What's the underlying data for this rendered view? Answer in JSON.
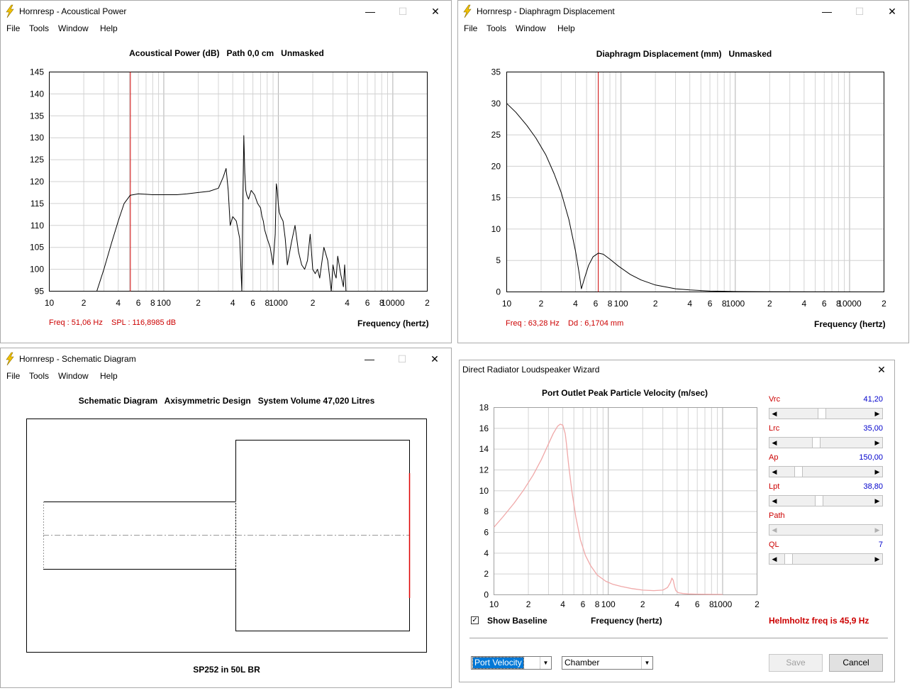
{
  "power_window": {
    "title": "Hornresp - Acoustical Power",
    "menu": [
      "File",
      "Tools",
      "Window",
      "Help"
    ],
    "chart_title": "Acoustical Power (dB)   Path 0,0 cm   Unmasked",
    "readout_freq": "Freq : 51,06 Hz",
    "readout_value": "SPL : 116,8985 dB",
    "xlabel": "Frequency (hertz)"
  },
  "displacement_window": {
    "title": "Hornresp - Diaphragm Displacement",
    "menu": [
      "File",
      "Tools",
      "Window",
      "Help"
    ],
    "chart_title": "Diaphragm Displacement (mm)   Unmasked",
    "readout_freq": "Freq : 63,28 Hz",
    "readout_value": "Dd : 6,1704 mm",
    "xlabel": "Frequency (hertz)"
  },
  "schematic_window": {
    "title": "Hornresp - Schematic Diagram",
    "menu": [
      "File",
      "Tools",
      "Window",
      "Help"
    ],
    "heading": "Schematic Diagram   Axisymmetric Design   System Volume 47,020 Litres",
    "caption": "SP252 in 50L BR"
  },
  "wizard_window": {
    "title": "Direct Radiator Loudspeaker Wizard",
    "chart_title": "Port Outlet Peak Particle Velocity (m/sec)",
    "xlabel": "Frequency (hertz)",
    "show_baseline_label": "Show Baseline",
    "show_baseline_checked": true,
    "helmholtz": "Helmholtz freq is 45,9 Hz",
    "sliders": [
      {
        "label": "Vrc",
        "value": "41,20",
        "level": 0.45
      },
      {
        "label": "Lrc",
        "value": "35,00",
        "level": 0.38
      },
      {
        "label": "Ap",
        "value": "150,00",
        "level": 0.17
      },
      {
        "label": "Lpt",
        "value": "38,80",
        "level": 0.41
      },
      {
        "label": "Path",
        "value": "",
        "level": 0.0
      },
      {
        "label": "QL",
        "value": "7",
        "level": 0.06
      }
    ],
    "combo_left": "Port Velocity",
    "combo_right": "Chamber",
    "save_label": "Save",
    "cancel_label": "Cancel"
  },
  "colors": {
    "curve": "#000000",
    "marker": "#cc0000",
    "velocity_curve": "#f0a8a8",
    "grid": "#c8c8c8"
  },
  "chart_data": [
    {
      "type": "line",
      "title": "Acoustical Power (dB)   Path 0,0 cm   Unmasked",
      "xlabel": "Frequency (hertz)",
      "xscale": "log",
      "xlim": [
        10,
        20000
      ],
      "ylim": [
        95,
        145
      ],
      "yticks": [
        95,
        100,
        105,
        110,
        115,
        120,
        125,
        130,
        135,
        140,
        145
      ],
      "xticklabels": [
        "10",
        "2",
        "4",
        "6",
        "8",
        "100",
        "2",
        "4",
        "6",
        "8",
        "1000",
        "2",
        "4",
        "6",
        "8",
        "10000",
        "2"
      ],
      "marker_x": 51.06,
      "series": [
        {
          "x": [
            26,
            30,
            35,
            40,
            45,
            51,
            60,
            70,
            80,
            100,
            130,
            160,
            200,
            250,
            300,
            330,
            350,
            365,
            380,
            400,
            430,
            460,
            480,
            490,
            500,
            510,
            520,
            530,
            550,
            580,
            620,
            660,
            700,
            720,
            740,
            760,
            800,
            850,
            900,
            940,
            960,
            980,
            1000,
            1020,
            1050,
            1100,
            1150,
            1200,
            1300,
            1400,
            1500,
            1600,
            1700,
            1800,
            1900,
            2000,
            2100,
            2200,
            2300,
            2500,
            2700,
            2900,
            3000,
            3100,
            3200,
            3300,
            3500,
            3700,
            3800,
            3900
          ],
          "y": [
            95,
            100,
            106,
            111,
            115,
            116.9,
            117.2,
            117.1,
            117,
            117,
            117,
            117.2,
            117.5,
            117.8,
            118.5,
            121,
            123,
            118,
            110,
            112,
            111,
            107,
            95,
            115,
            130.5,
            122,
            118,
            117,
            116,
            118,
            117,
            115,
            114,
            112,
            111,
            109,
            107,
            105,
            101,
            108,
            119.5,
            118,
            115,
            113,
            112,
            111,
            107,
            101,
            106,
            110,
            104,
            101,
            100,
            102,
            108,
            100,
            99,
            100,
            98,
            105,
            102,
            95,
            101,
            99,
            98,
            103,
            99,
            96,
            101,
            95
          ]
        }
      ]
    },
    {
      "type": "line",
      "title": "Diaphragm Displacement (mm)   Unmasked",
      "xlabel": "Frequency (hertz)",
      "xscale": "log",
      "xlim": [
        10,
        20000
      ],
      "ylim": [
        0,
        35
      ],
      "yticks": [
        0,
        5,
        10,
        15,
        20,
        25,
        30,
        35
      ],
      "xticklabels": [
        "10",
        "2",
        "4",
        "6",
        "8",
        "100",
        "2",
        "4",
        "6",
        "8",
        "1000",
        "2",
        "4",
        "6",
        "8",
        "10000",
        "2"
      ],
      "marker_x": 63.28,
      "series": [
        {
          "x": [
            10,
            12,
            15,
            18,
            22,
            26,
            30,
            35,
            40,
            43,
            45,
            48,
            52,
            57,
            63.28,
            70,
            80,
            95,
            120,
            150,
            200,
            300,
            400,
            600,
            1000,
            2000,
            5000,
            20000
          ],
          "y": [
            30,
            28.6,
            26.5,
            24.5,
            21.8,
            18.8,
            15.8,
            11.5,
            6.5,
            3,
            0.5,
            2.2,
            4.2,
            5.6,
            6.17,
            6,
            5.2,
            4.1,
            2.8,
            1.9,
            1.1,
            0.5,
            0.3,
            0.15,
            0.06,
            0.03,
            0.01,
            0
          ]
        }
      ]
    },
    {
      "type": "line",
      "title": "Port Outlet Peak Particle Velocity (m/sec)",
      "xlabel": "Frequency (hertz)",
      "xscale": "log",
      "xlim": [
        10,
        2000
      ],
      "ylim": [
        0,
        18
      ],
      "yticks": [
        0,
        2,
        4,
        6,
        8,
        10,
        12,
        14,
        16,
        18
      ],
      "xticklabels": [
        "10",
        "2",
        "4",
        "6",
        "8",
        "100",
        "2",
        "4",
        "6",
        "8",
        "1000",
        "2"
      ],
      "series": [
        {
          "x": [
            10,
            12,
            15,
            18,
            22,
            26,
            30,
            33,
            36,
            38,
            40,
            42,
            43,
            45,
            48,
            52,
            57,
            63,
            70,
            80,
            95,
            110,
            130,
            160,
            200,
            250,
            300,
            330,
            350,
            360,
            370,
            380,
            390,
            410,
            450,
            500,
            600,
            800,
            1000
          ],
          "y": [
            6.5,
            7.5,
            8.8,
            10,
            11.5,
            13,
            14.5,
            15.5,
            16.2,
            16.4,
            16.3,
            15.5,
            14.6,
            12.5,
            10,
            7.5,
            5.3,
            3.8,
            2.8,
            1.9,
            1.3,
            1,
            0.8,
            0.6,
            0.45,
            0.4,
            0.45,
            0.7,
            1.2,
            1.6,
            1.4,
            0.8,
            0.4,
            0.2,
            0.12,
            0.08,
            0.06,
            0.04,
            0.03
          ]
        }
      ]
    }
  ]
}
